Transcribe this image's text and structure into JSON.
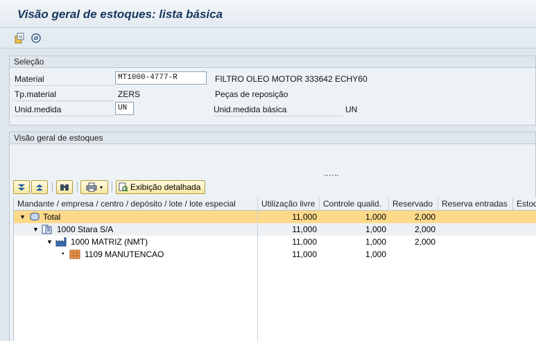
{
  "window": {
    "title": "Visão geral de estoques: lista básica"
  },
  "app_toolbar": {
    "icons": [
      "select-icon",
      "refresh-icon"
    ]
  },
  "selection": {
    "header": "Seleção",
    "material": {
      "label": "Material",
      "value": "MT1000-4777-R",
      "description": "FILTRO OLEO MOTOR 333642 ECHY60"
    },
    "material_type": {
      "label": "Tp.material",
      "value": "ZERS",
      "description": "Peças de reposição"
    },
    "unit": {
      "label": "Unid.medida",
      "value": "UN",
      "base_label": "Unid.medida básica",
      "base_value": "UN"
    }
  },
  "overview": {
    "header": "Visão geral de estoques",
    "toolbar": {
      "detail_button": "Exibição detalhada"
    },
    "columns": [
      "Mandante / empresa / centro / depósito / lote / lote especial",
      "Utilização livre",
      "Controle qualid.",
      "Reservado",
      "Reserva entradas",
      "Estoq"
    ],
    "rows": [
      {
        "name": "Total",
        "free": "11,000",
        "qc": "1,000",
        "reserved": "2,000",
        "icon": "total-icon",
        "expander": "▼"
      },
      {
        "name": "1000 Stara S/A",
        "free": "11,000",
        "qc": "1,000",
        "reserved": "2,000",
        "icon": "company-icon",
        "expander": "▼"
      },
      {
        "name": "1000 MATRIZ (NMT)",
        "free": "11,000",
        "qc": "1,000",
        "reserved": "2,000",
        "icon": "plant-icon",
        "expander": "▼"
      },
      {
        "name": "1109 MANUTENCAO",
        "free": "11,000",
        "qc": "1,000",
        "reserved": "",
        "icon": "storage-location-icon",
        "expander": "•"
      }
    ]
  },
  "colors": {
    "title": "#17365d",
    "total_row": "#fdd98a",
    "button_bg": "#f5e7a3"
  }
}
